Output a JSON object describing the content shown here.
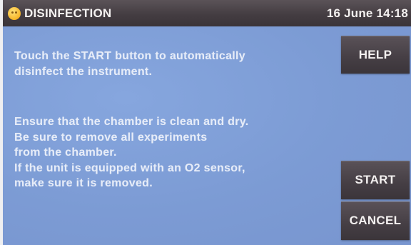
{
  "header": {
    "title": "DISINFECTION",
    "datetime": "16 June 14:18",
    "icon": "warning-face-icon",
    "icon_color": "#f6b527"
  },
  "message": {
    "intro_lines": [
      "Touch the START button to automatically",
      "disinfect the instrument."
    ],
    "instruction_lines": [
      "Ensure that the chamber is clean and dry.",
      "Be sure to remove all experiments",
      "from the chamber.",
      "If the unit is equipped with an O2 sensor,",
      "make sure it is removed."
    ]
  },
  "buttons": {
    "help_label": "HELP",
    "start_label": "START",
    "cancel_label": "CANCEL"
  },
  "colors": {
    "screen_background": "#7e9ed6",
    "bar_background": "#443d42",
    "text": "#e6ecf8"
  }
}
